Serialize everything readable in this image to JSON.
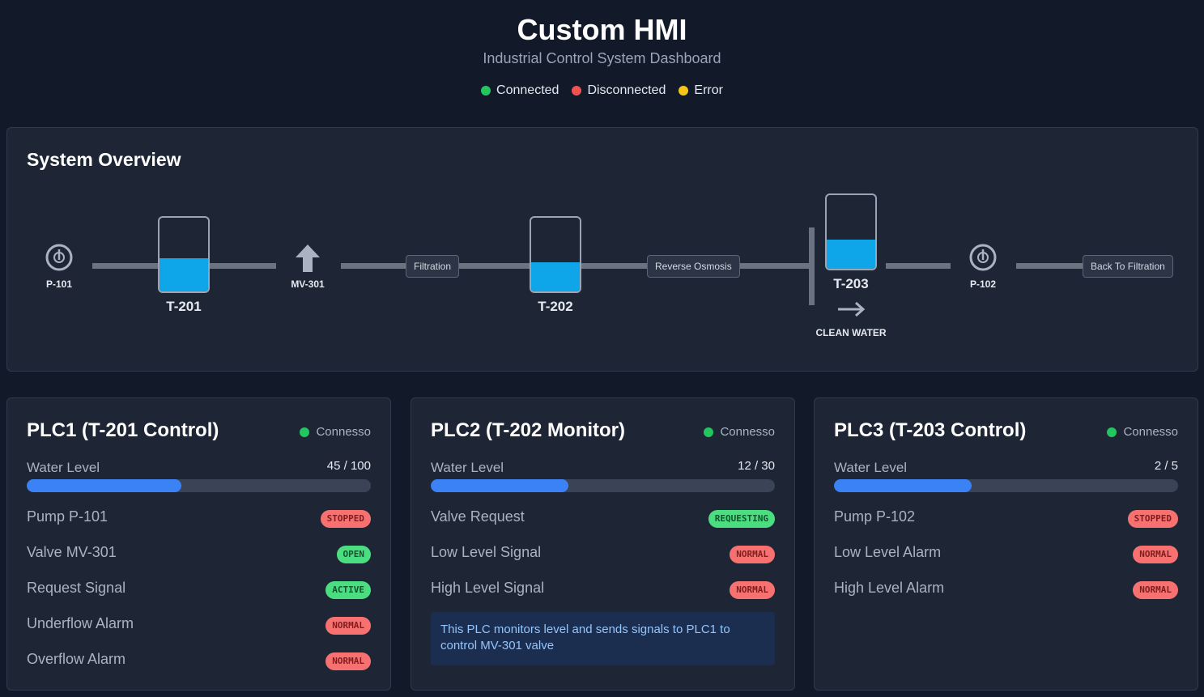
{
  "header": {
    "title": "Custom HMI",
    "subtitle": "Industrial Control System Dashboard",
    "legend": [
      {
        "label": "Connected",
        "color": "#22c55e"
      },
      {
        "label": "Disconnected",
        "color": "#f05252"
      },
      {
        "label": "Error",
        "color": "#f5c518"
      }
    ]
  },
  "overview": {
    "title": "System Overview",
    "pump1": {
      "label": "P-101",
      "icon": "pump-icon"
    },
    "tank1": {
      "label": "T-201",
      "level_fraction": 0.45
    },
    "valve": {
      "label": "MV-301",
      "icon": "arrow-up-icon"
    },
    "proc1": {
      "label": "Filtration"
    },
    "tank2": {
      "label": "T-202",
      "level_fraction": 0.4
    },
    "proc2": {
      "label": "Reverse Osmosis"
    },
    "tank3": {
      "label": "T-203",
      "level_fraction": 0.4
    },
    "clean_water": {
      "label": "CLEAN WATER",
      "icon": "arrow-right-icon"
    },
    "pump2": {
      "label": "P-102",
      "icon": "pump-icon"
    },
    "proc3": {
      "label": "Back To Filtration"
    }
  },
  "plcs": [
    {
      "title": "PLC1 (T-201 Control)",
      "status": "Connesso",
      "status_color": "#22c55e",
      "water_level_label": "Water Level",
      "water_level_value": "45 / 100",
      "water_level_fraction": 0.45,
      "rows": [
        {
          "label": "Pump P-101",
          "badge": "STOPPED",
          "color": "red"
        },
        {
          "label": "Valve MV-301",
          "badge": "OPEN",
          "color": "green"
        },
        {
          "label": "Request Signal",
          "badge": "ACTIVE",
          "color": "green"
        },
        {
          "label": "Underflow Alarm",
          "badge": "NORMAL",
          "color": "red"
        },
        {
          "label": "Overflow Alarm",
          "badge": "NORMAL",
          "color": "red"
        }
      ]
    },
    {
      "title": "PLC2 (T-202 Monitor)",
      "status": "Connesso",
      "status_color": "#22c55e",
      "water_level_label": "Water Level",
      "water_level_value": "12 / 30",
      "water_level_fraction": 0.4,
      "rows": [
        {
          "label": "Valve Request",
          "badge": "REQUESTING",
          "color": "green"
        },
        {
          "label": "Low Level Signal",
          "badge": "NORMAL",
          "color": "red"
        },
        {
          "label": "High Level Signal",
          "badge": "NORMAL",
          "color": "red"
        }
      ],
      "info": "This PLC monitors level and sends signals to PLC1 to control MV-301 valve"
    },
    {
      "title": "PLC3 (T-203 Control)",
      "status": "Connesso",
      "status_color": "#22c55e",
      "water_level_label": "Water Level",
      "water_level_value": "2 / 5",
      "water_level_fraction": 0.4,
      "rows": [
        {
          "label": "Pump P-102",
          "badge": "STOPPED",
          "color": "red"
        },
        {
          "label": "Low Level Alarm",
          "badge": "NORMAL",
          "color": "red"
        },
        {
          "label": "High Level Alarm",
          "badge": "NORMAL",
          "color": "red"
        }
      ]
    }
  ]
}
